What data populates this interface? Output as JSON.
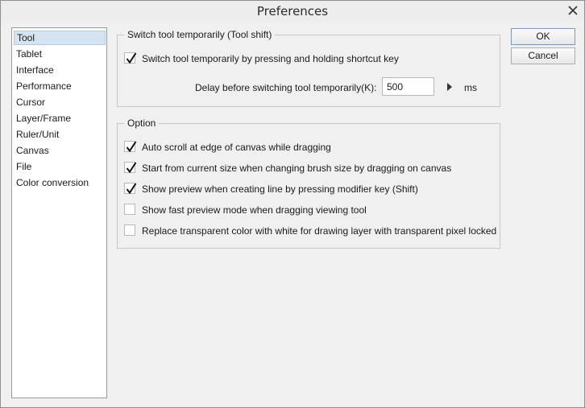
{
  "window": {
    "title": "Preferences"
  },
  "sidebar": {
    "items": [
      {
        "label": "Tool",
        "selected": true
      },
      {
        "label": "Tablet"
      },
      {
        "label": "Interface"
      },
      {
        "label": "Performance"
      },
      {
        "label": "Cursor"
      },
      {
        "label": "Layer/Frame"
      },
      {
        "label": "Ruler/Unit"
      },
      {
        "label": "Canvas"
      },
      {
        "label": "File"
      },
      {
        "label": "Color conversion"
      }
    ]
  },
  "tool_shift": {
    "title": "Switch tool temporarily (Tool shift)",
    "switch_label": "Switch tool temporarily by pressing and holding shortcut key",
    "switch_checked": true,
    "delay_label": "Delay before switching tool temporarily(K):",
    "delay_value": "500",
    "delay_unit": "ms"
  },
  "option": {
    "title": "Option",
    "items": [
      {
        "label": "Auto scroll at edge of canvas while dragging",
        "checked": true
      },
      {
        "label": "Start from current size when changing brush size by dragging on canvas",
        "checked": true
      },
      {
        "label": "Show preview when creating line by pressing modifier key (Shift)",
        "checked": true
      },
      {
        "label": "Show fast preview mode when dragging viewing tool",
        "checked": false
      },
      {
        "label": "Replace transparent color with white for drawing layer with transparent pixel locked",
        "checked": false
      }
    ]
  },
  "buttons": {
    "ok": "OK",
    "cancel": "Cancel"
  },
  "icons": {
    "close": "close-icon",
    "check": "checkmark-icon",
    "arrow": "triangle-right-icon"
  }
}
